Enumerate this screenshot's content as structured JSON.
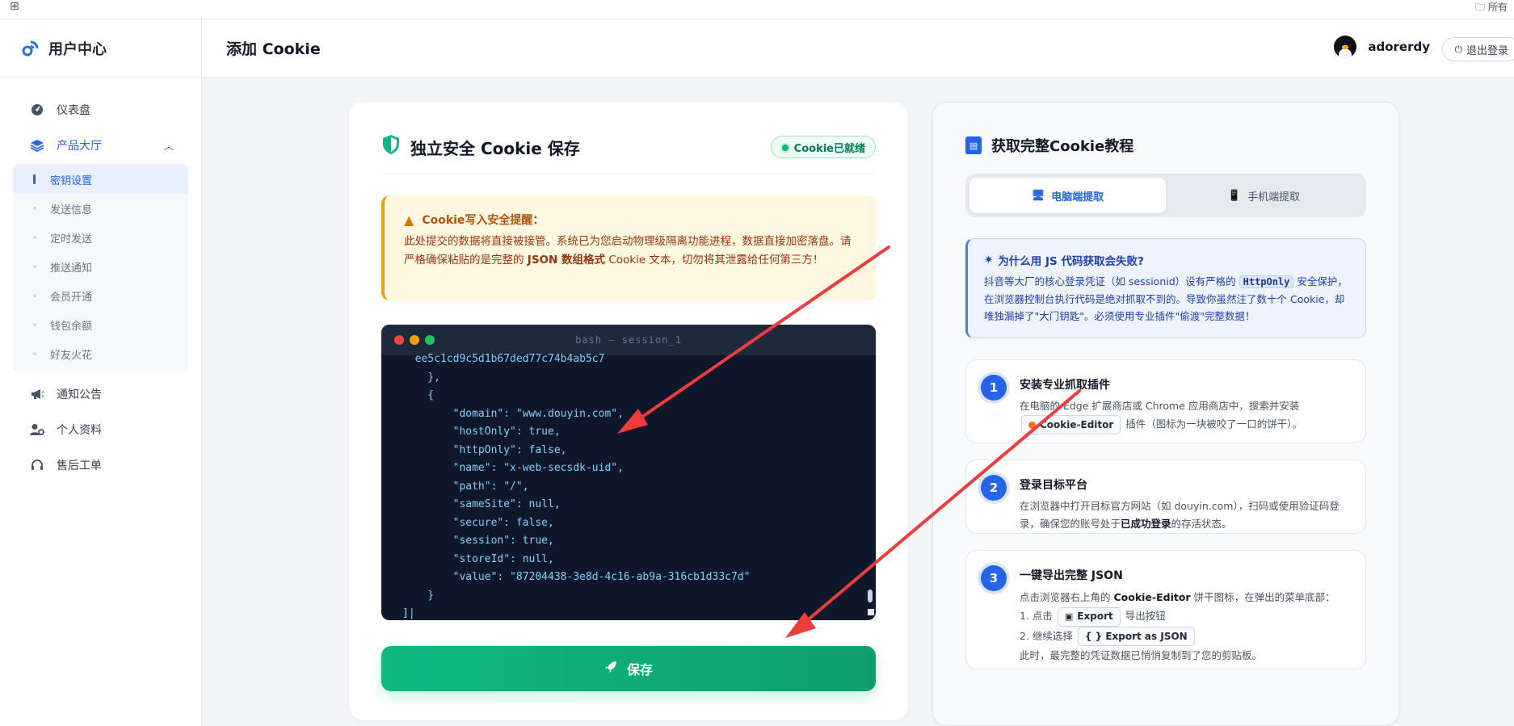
{
  "browser": {
    "apps_icon": "apps-grid-icon",
    "folder_label": "所有"
  },
  "sidebar": {
    "brand": "用户中心",
    "items": [
      {
        "label": "仪表盘",
        "icon": "dashboard-icon"
      },
      {
        "label": "产品大厅",
        "icon": "layers-icon"
      },
      {
        "label": "通知公告",
        "icon": "megaphone-icon"
      },
      {
        "label": "个人资料",
        "icon": "user-cog-icon"
      },
      {
        "label": "售后工单",
        "icon": "headset-icon"
      }
    ],
    "subitems": [
      "密钥设置",
      "发送信息",
      "定时发送",
      "推送通知",
      "会员开通",
      "钱包余额",
      "好友火花"
    ]
  },
  "header": {
    "title": "添加 Cookie",
    "username": "adorerdy",
    "logout": "退出登录"
  },
  "left_card": {
    "title": "独立安全 Cookie 保存",
    "badge": "Cookie已就绪",
    "warning": {
      "title": "Cookie写入安全提醒：",
      "text_1": "此处提交的数据将直接被接管。系统已为您启动物理级隔离功能进程，数据直接加密落盘。请严格确保粘贴的是完整的 ",
      "text_bold": "JSON 数组格式",
      "text_2": " Cookie 文本，切勿将其泄露给任何第三方！"
    },
    "terminal": {
      "title": "bash — session_1",
      "code": "  ee5c1cd9c5d1b67ded77c74b4ab5c7\n    },\n    {\n        \"domain\": \"www.douyin.com\",\n        \"hostOnly\": true,\n        \"httpOnly\": false,\n        \"name\": \"x-web-secsdk-uid\",\n        \"path\": \"/\",\n        \"sameSite\": null,\n        \"secure\": false,\n        \"session\": true,\n        \"storeId\": null,\n        \"value\": \"87204438-3e8d-4c16-ab9a-316cb1d33c7d\"\n    }\n]|"
    },
    "save": "保存"
  },
  "right_card": {
    "title": "获取完整Cookie教程",
    "tabs": [
      "电脑端提取",
      "手机端提取"
    ],
    "info": {
      "title": "为什么用 JS 代码获取会失败?",
      "text_1": "抖音等大厂的核心登录凭证（如 sessionid）设有严格的 ",
      "code": "HttpOnly",
      "text_2": " 安全保护，在浏览器控制台执行代码是绝对抓取不到的。导致你虽然注了数十个 Cookie，却唯独漏掉了\"大门钥匙\"。必须使用专业插件\"偷渡\"完整数据！"
    },
    "steps": [
      {
        "num": "1",
        "title": "安装专业抓取插件",
        "text_1": "在电脑的 Edge 扩展商店或 Chrome 应用商店中，搜索并安装",
        "chip": "Cookie-Editor",
        "text_2": " 插件（图标为一块被咬了一口的饼干）。"
      },
      {
        "num": "2",
        "title": "登录目标平台",
        "text_1": "在浏览器中打开目标官方网站（如 douyin.com），扫码或使用验证码登录，确保您的账号处于",
        "text_bold": "已成功登录",
        "text_2": "的存活状态。"
      },
      {
        "num": "3",
        "title": "一键导出完整 JSON",
        "text_1": "点击浏览器右上角的 ",
        "text_bold": "Cookie-Editor",
        "text_2": " 饼干图标，在弹出的菜单底部：",
        "line_a_1": "1. 点击",
        "chip_a": "Export",
        "line_a_2": "导出按钮",
        "line_b_1": "2. 继续选择",
        "chip_b": "{ } Export as JSON",
        "line_c": "此时，最完整的凭证数据已悄悄复制到了您的剪贴板。"
      }
    ]
  },
  "colors": {
    "accent": "#2563eb",
    "success": "#10b981",
    "warning": "#f59e0b",
    "annotation": "#ef3b3b"
  }
}
